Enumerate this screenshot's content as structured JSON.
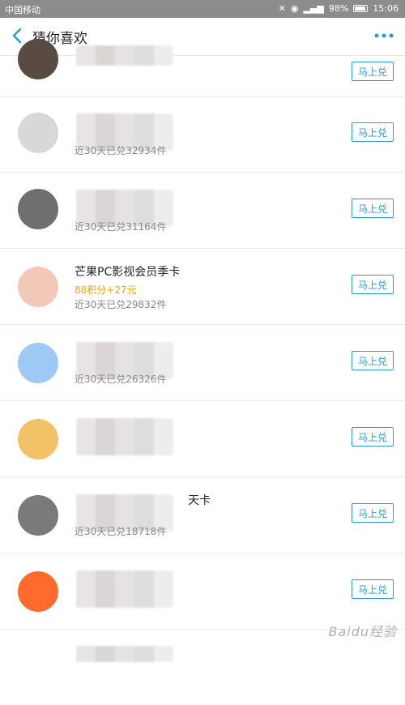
{
  "status_bar": {
    "carrier": "中国移动",
    "battery": "98%",
    "time": "15:06"
  },
  "nav": {
    "title": "猜你喜欢"
  },
  "items": [
    {
      "name": "",
      "price": "",
      "sold": "",
      "button": "马上兑",
      "avatar_color": "#5a4a44"
    },
    {
      "name": "",
      "price": "",
      "sold": "近30天已兑32934件",
      "button": "马上兑",
      "avatar_color": "#d8d8d8"
    },
    {
      "name": "",
      "price": "",
      "sold": "近30天已兑31164件",
      "button": "马上兑",
      "avatar_color": "#6f6f6f"
    },
    {
      "name": "芒果PC影视会员季卡",
      "price": "88积分+27元",
      "sold": "近30天已兑29832件",
      "button": "马上兑",
      "avatar_color": "#f3c8b8"
    },
    {
      "name": "",
      "price": "",
      "sold": "近30天已兑26326件",
      "button": "马上兑",
      "avatar_color": "#9ec9f5"
    },
    {
      "name": "",
      "price": "",
      "sold": "",
      "button": "马上兑",
      "avatar_color": "#f2c267"
    },
    {
      "name": "天卡",
      "price": "",
      "sold": "近30天已兑18718件",
      "button": "马上兑",
      "avatar_color": "#7a7a7a"
    },
    {
      "name": "",
      "price": "",
      "sold": "",
      "button": "马上兑",
      "avatar_color": "#ff6b2d"
    },
    {
      "name": "",
      "price": "",
      "sold": "",
      "button": "",
      "avatar_color": "#cccccc"
    }
  ],
  "watermark": "Baidu经验",
  "icons": {
    "back": "back-icon",
    "more": "more-icon"
  }
}
